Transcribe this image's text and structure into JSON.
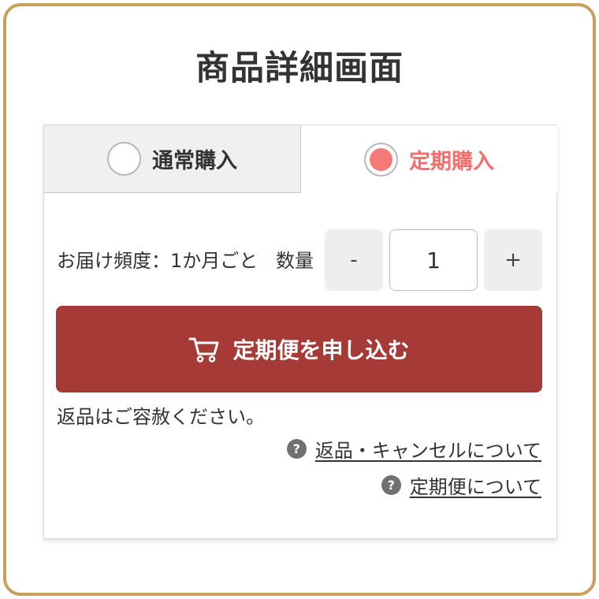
{
  "page": {
    "title": "商品詳細画面"
  },
  "purchase_tabs": [
    {
      "label": "通常購入",
      "selected": false
    },
    {
      "label": "定期購入",
      "selected": true
    }
  ],
  "subscription": {
    "frequency_text": "お届け頻度：1か月ごと",
    "quantity_label": "数量",
    "quantity_minus": "-",
    "quantity_value": "1",
    "quantity_plus": "+",
    "submit_label": "定期便を申し込む",
    "submit_icon": "cart-icon",
    "return_note": "返品はご容赦ください。"
  },
  "help_links": [
    {
      "icon": "question",
      "icon_glyph": "?",
      "label": "返品・キャンセルについて"
    },
    {
      "icon": "question",
      "icon_glyph": "?",
      "label": "定期便について"
    }
  ],
  "colors": {
    "frame_border": "#c9a05a",
    "accent": "#f26f6b",
    "cta_background": "#a63a37"
  }
}
